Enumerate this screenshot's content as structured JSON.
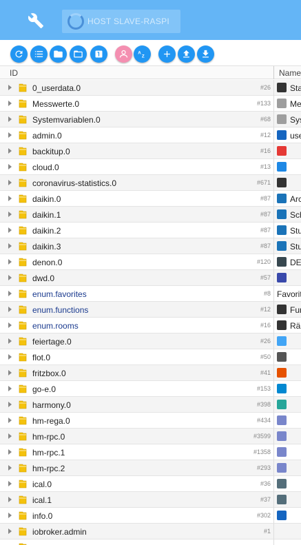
{
  "host": {
    "label": "HOST SLAVE-RASPI"
  },
  "toolbar": {
    "buttons": [
      "refresh",
      "list",
      "folder-closed",
      "folder-open",
      "number",
      "expert-mode",
      "sort-az",
      "add",
      "upload",
      "download"
    ]
  },
  "columns": {
    "id": "ID",
    "name": "Name"
  },
  "rows": [
    {
      "name": "0_userdata.0",
      "count": "#26",
      "enum": false,
      "icon_color": "#333333",
      "icon": "document-icon",
      "name_col": "Sta"
    },
    {
      "name": "Messwerte.0",
      "count": "#133",
      "enum": false,
      "icon_color": "#9e9e9e",
      "icon": "gauge-icon",
      "name_col": "Me"
    },
    {
      "name": "Systemvariablen.0",
      "count": "#68",
      "enum": false,
      "icon_color": "#9e9e9e",
      "icon": "gauge-icon",
      "name_col": "Sys"
    },
    {
      "name": "admin.0",
      "count": "#12",
      "enum": false,
      "icon_color": "#1565c0",
      "icon": "power-icon",
      "name_col": "use"
    },
    {
      "name": "backitup.0",
      "count": "#16",
      "enum": false,
      "icon_color": "#e53935",
      "icon": "backup-icon",
      "name_col": ""
    },
    {
      "name": "cloud.0",
      "count": "#13",
      "enum": false,
      "icon_color": "#1e88e5",
      "icon": "cloud-icon",
      "name_col": ""
    },
    {
      "name": "coronavirus-statistics.0",
      "count": "#671",
      "enum": false,
      "icon_color": "#333333",
      "icon": "virus-icon",
      "name_col": ""
    },
    {
      "name": "daikin.0",
      "count": "#87",
      "enum": false,
      "icon_color": "#1a73b8",
      "icon": "daikin-icon",
      "name_col": "Arc"
    },
    {
      "name": "daikin.1",
      "count": "#87",
      "enum": false,
      "icon_color": "#1a73b8",
      "icon": "daikin-icon",
      "name_col": "Sch"
    },
    {
      "name": "daikin.2",
      "count": "#87",
      "enum": false,
      "icon_color": "#1a73b8",
      "icon": "daikin-icon",
      "name_col": "Stu"
    },
    {
      "name": "daikin.3",
      "count": "#87",
      "enum": false,
      "icon_color": "#1a73b8",
      "icon": "daikin-icon",
      "name_col": "Stu"
    },
    {
      "name": "denon.0",
      "count": "#120",
      "enum": false,
      "icon_color": "#37474f",
      "icon": "receiver-icon",
      "name_col": "DE"
    },
    {
      "name": "dwd.0",
      "count": "#57",
      "enum": false,
      "icon_color": "#3949ab",
      "icon": "weather-icon",
      "name_col": ""
    },
    {
      "name": "enum.favorites",
      "count": "#8",
      "enum": true,
      "icon_color": "",
      "icon": "",
      "name_col": "Favorit"
    },
    {
      "name": "enum.functions",
      "count": "#12",
      "enum": true,
      "icon_color": "#333333",
      "icon": "bulb-icon",
      "name_col": "Fun"
    },
    {
      "name": "enum.rooms",
      "count": "#16",
      "enum": true,
      "icon_color": "#333333",
      "icon": "home-icon",
      "name_col": "Räu"
    },
    {
      "name": "feiertage.0",
      "count": "#26",
      "enum": false,
      "icon_color": "#42a5f5",
      "icon": "calendar-icon",
      "name_col": ""
    },
    {
      "name": "flot.0",
      "count": "#50",
      "enum": false,
      "icon_color": "#555555",
      "icon": "flot-icon",
      "name_col": ""
    },
    {
      "name": "fritzbox.0",
      "count": "#41",
      "enum": false,
      "icon_color": "#e65100",
      "icon": "fritz-icon",
      "name_col": ""
    },
    {
      "name": "go-e.0",
      "count": "#153",
      "enum": false,
      "icon_color": "#0288d1",
      "icon": "goe-icon",
      "name_col": ""
    },
    {
      "name": "harmony.0",
      "count": "#398",
      "enum": false,
      "icon_color": "#26a69a",
      "icon": "harmony-icon",
      "name_col": ""
    },
    {
      "name": "hm-rega.0",
      "count": "#434",
      "enum": false,
      "icon_color": "#7986cb",
      "icon": "homematic-icon",
      "name_col": ""
    },
    {
      "name": "hm-rpc.0",
      "count": "#3599",
      "enum": false,
      "icon_color": "#7986cb",
      "icon": "homematic-icon",
      "name_col": ""
    },
    {
      "name": "hm-rpc.1",
      "count": "#1358",
      "enum": false,
      "icon_color": "#7986cb",
      "icon": "homematic-icon",
      "name_col": ""
    },
    {
      "name": "hm-rpc.2",
      "count": "#293",
      "enum": false,
      "icon_color": "#7986cb",
      "icon": "homematic-icon",
      "name_col": ""
    },
    {
      "name": "ical.0",
      "count": "#36",
      "enum": false,
      "icon_color": "#546e7a",
      "icon": "ical-icon",
      "name_col": ""
    },
    {
      "name": "ical.1",
      "count": "#37",
      "enum": false,
      "icon_color": "#546e7a",
      "icon": "ical-icon",
      "name_col": ""
    },
    {
      "name": "info.0",
      "count": "#302",
      "enum": false,
      "icon_color": "#1565c0",
      "icon": "info-icon",
      "name_col": ""
    },
    {
      "name": "iobroker.admin",
      "count": "#1",
      "enum": false,
      "icon_color": "",
      "icon": "",
      "name_col": ""
    },
    {
      "name": "",
      "count": "",
      "enum": false,
      "icon_color": "",
      "icon": "",
      "name_col": ""
    }
  ],
  "colors": {
    "topbar": "#64b5f6",
    "button": "#2196f3",
    "expert_button": "#f48fb1",
    "folder": "#f4c20d"
  }
}
